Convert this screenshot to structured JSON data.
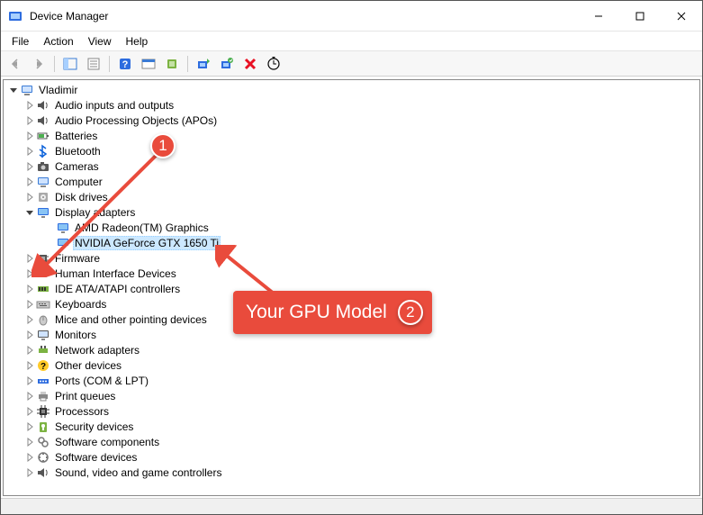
{
  "window": {
    "title": "Device Manager"
  },
  "menu": [
    "File",
    "Action",
    "View",
    "Help"
  ],
  "toolbar": {
    "back": "back-icon",
    "forward": "forward-icon",
    "showhide": "showhide-tree-icon",
    "properties": "properties-icon",
    "help": "help-icon",
    "events": "events-icon",
    "legacy": "legacy-icon",
    "update": "update-icon",
    "uninstall": "uninstall-icon",
    "disable": "disable-icon",
    "scan": "scan-icon"
  },
  "root": {
    "label": "Vladimir"
  },
  "nodes": [
    {
      "id": "audio-io",
      "label": "Audio inputs and outputs",
      "icon": "speaker-icon",
      "expanded": false
    },
    {
      "id": "audio-apo",
      "label": "Audio Processing Objects (APOs)",
      "icon": "speaker-icon",
      "expanded": false
    },
    {
      "id": "batteries",
      "label": "Batteries",
      "icon": "battery-icon",
      "expanded": false
    },
    {
      "id": "bluetooth",
      "label": "Bluetooth",
      "icon": "bluetooth-icon",
      "expanded": false
    },
    {
      "id": "cameras",
      "label": "Cameras",
      "icon": "camera-icon",
      "expanded": false
    },
    {
      "id": "computer",
      "label": "Computer",
      "icon": "computer-icon",
      "expanded": false
    },
    {
      "id": "disk",
      "label": "Disk drives",
      "icon": "disk-icon",
      "expanded": false
    },
    {
      "id": "display",
      "label": "Display adapters",
      "icon": "monitor-icon",
      "expanded": true,
      "children": [
        {
          "id": "amd",
          "label": "AMD Radeon(TM) Graphics",
          "icon": "monitor-icon",
          "selected": false
        },
        {
          "id": "nvidia",
          "label": "NVIDIA GeForce GTX 1650 Ti",
          "icon": "monitor-icon",
          "selected": true
        }
      ]
    },
    {
      "id": "firmware",
      "label": "Firmware",
      "icon": "chip-icon",
      "expanded": false
    },
    {
      "id": "hid",
      "label": "Human Interface Devices",
      "icon": "hid-icon",
      "expanded": false
    },
    {
      "id": "ide",
      "label": "IDE ATA/ATAPI controllers",
      "icon": "ide-icon",
      "expanded": false
    },
    {
      "id": "keyboards",
      "label": "Keyboards",
      "icon": "keyboard-icon",
      "expanded": false
    },
    {
      "id": "mice",
      "label": "Mice and other pointing devices",
      "icon": "mouse-icon",
      "expanded": false
    },
    {
      "id": "monitors",
      "label": "Monitors",
      "icon": "monitor2-icon",
      "expanded": false
    },
    {
      "id": "network",
      "label": "Network adapters",
      "icon": "network-icon",
      "expanded": false
    },
    {
      "id": "other",
      "label": "Other devices",
      "icon": "unknown-icon",
      "expanded": false
    },
    {
      "id": "ports",
      "label": "Ports (COM & LPT)",
      "icon": "port-icon",
      "expanded": false
    },
    {
      "id": "printq",
      "label": "Print queues",
      "icon": "printer-icon",
      "expanded": false
    },
    {
      "id": "processors",
      "label": "Processors",
      "icon": "cpu-icon",
      "expanded": false
    },
    {
      "id": "security",
      "label": "Security devices",
      "icon": "security-icon",
      "expanded": false
    },
    {
      "id": "softcomp",
      "label": "Software components",
      "icon": "softcomp-icon",
      "expanded": false
    },
    {
      "id": "softdev",
      "label": "Software devices",
      "icon": "softdev-icon",
      "expanded": false
    },
    {
      "id": "svgc",
      "label": "Sound, video and game controllers",
      "icon": "speaker-icon",
      "expanded": false,
      "cut": true
    }
  ],
  "annotation": {
    "badge1": "1",
    "badge2": "2",
    "label": "Your GPU Model"
  }
}
